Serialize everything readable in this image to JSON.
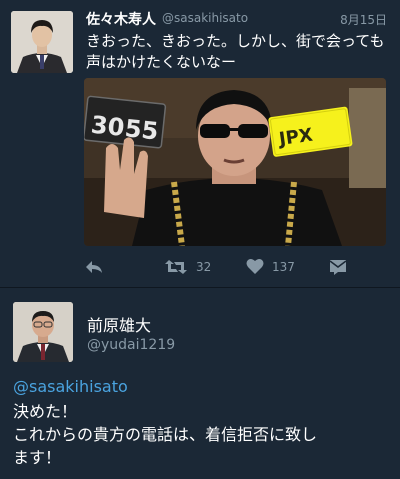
{
  "tweet1": {
    "author_name": "佐々木寿人",
    "handle": "@sasakihisato",
    "date": "8月15日",
    "text_lines": [
      "きおった、きおった。しかし、街で会っても",
      "声はかけたくないなー"
    ],
    "media_plate_text": "JPX",
    "actions": {
      "reply_icon": "reply-icon",
      "retweet_icon": "retweet-icon",
      "retweet_count": "32",
      "like_icon": "heart-icon",
      "like_count": "137",
      "dm_icon": "message-icon"
    }
  },
  "tweet2": {
    "author_name": "前原雄大",
    "handle": "@yudai1219",
    "mention": "@sasakihisato",
    "text_lines": [
      "決めた！",
      "これからの貴方の電話は、着信拒否に致し",
      "ます！"
    ]
  },
  "colors": {
    "background": "#1b2836",
    "secondary_text": "#8899a6",
    "link": "#4aa3df"
  }
}
